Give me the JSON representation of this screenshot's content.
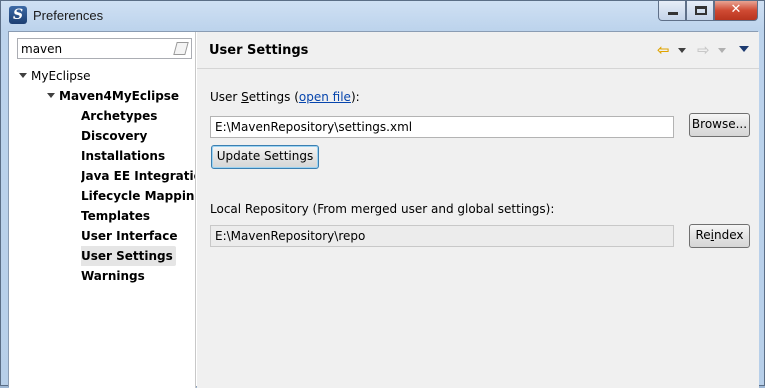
{
  "window": {
    "title": "Preferences",
    "app_icon_glyph": "S"
  },
  "caption_buttons": [
    "minimize-icon",
    "maximize-icon",
    "close-icon"
  ],
  "filter": {
    "value": "maven",
    "clear_icon": "clear-filter-icon"
  },
  "tree": {
    "root": "MyEclipse",
    "group": "Maven4MyEclipse",
    "items": [
      {
        "label": "Archetypes"
      },
      {
        "label": "Discovery"
      },
      {
        "label": "Installations"
      },
      {
        "label": "Java EE Integration"
      },
      {
        "label": "Lifecycle Mappings"
      },
      {
        "label": "Templates"
      },
      {
        "label": "User Interface"
      },
      {
        "label": "User Settings",
        "selected": true
      },
      {
        "label": "Warnings"
      }
    ]
  },
  "page": {
    "title": "User Settings",
    "nav_icons": [
      "back-arrow-icon",
      "forward-arrow-icon",
      "view-menu-icon"
    ]
  },
  "user_settings": {
    "label_prefix_u": "User ",
    "label_prefix_mnemonic": "S",
    "label_prefix_rest": "ettings (",
    "link": "open file",
    "label_suffix": "):",
    "value": "E:\\MavenRepository\\settings.xml",
    "browse_label": "Browse...",
    "update_label": "Update Settings"
  },
  "local_repo": {
    "label": "Local Repository (From merged user and global settings):",
    "value": "E:\\MavenRepository\\repo",
    "reindex_pre": "Re",
    "reindex_mnemonic": "i",
    "reindex_post": "ndex"
  }
}
